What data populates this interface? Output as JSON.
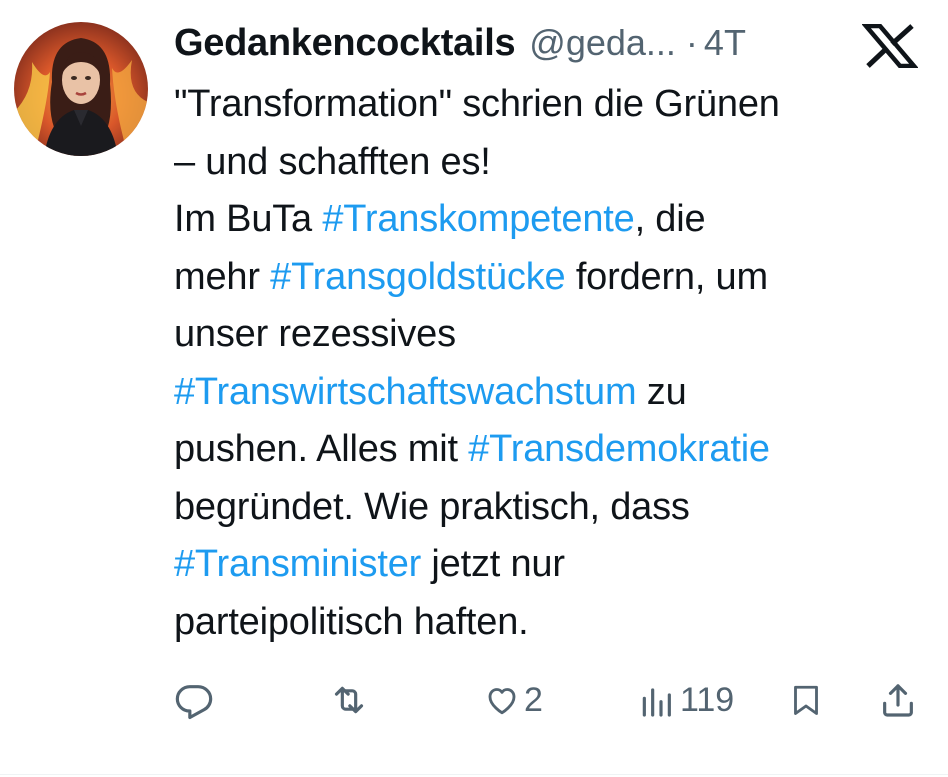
{
  "tweet": {
    "author": {
      "display_name": "Gedankencocktails",
      "handle": "@geda...",
      "separator": "·",
      "timestamp": "4T",
      "avatar_icon": "profile-avatar"
    },
    "platform_icon": "x-logo-icon",
    "text": {
      "l1": "\"Transformation\" schrien die Grünen",
      "l2": "– und schafften es!",
      "l3_a": "Im BuTa ",
      "l3_tag": "#Transkompetente",
      "l3_b": ", die",
      "l4_a": "mehr ",
      "l4_tag": "#Transgoldstücke",
      "l4_b": " fordern, um",
      "l5": "unser rezessives",
      "l6_tag": "#Transwirtschaftswachstum",
      "l6_b": " zu",
      "l7_a": "pushen. Alles mit ",
      "l7_tag": "#Transdemokratie",
      "l8": "begründet. Wie praktisch, dass",
      "l9_tag": "#Transminister",
      "l9_b": " jetzt nur",
      "l10": "parteipolitisch haften."
    },
    "actions": {
      "reply": {
        "icon": "reply-icon"
      },
      "retweet": {
        "icon": "retweet-icon"
      },
      "like": {
        "icon": "heart-icon",
        "count": "2"
      },
      "views": {
        "icon": "views-icon",
        "count": "119"
      },
      "bookmark": {
        "icon": "bookmark-icon"
      },
      "share": {
        "icon": "share-icon"
      }
    },
    "colors": {
      "text": "#0f1419",
      "secondary": "#536471",
      "hashtag": "#1d9bf0"
    }
  }
}
